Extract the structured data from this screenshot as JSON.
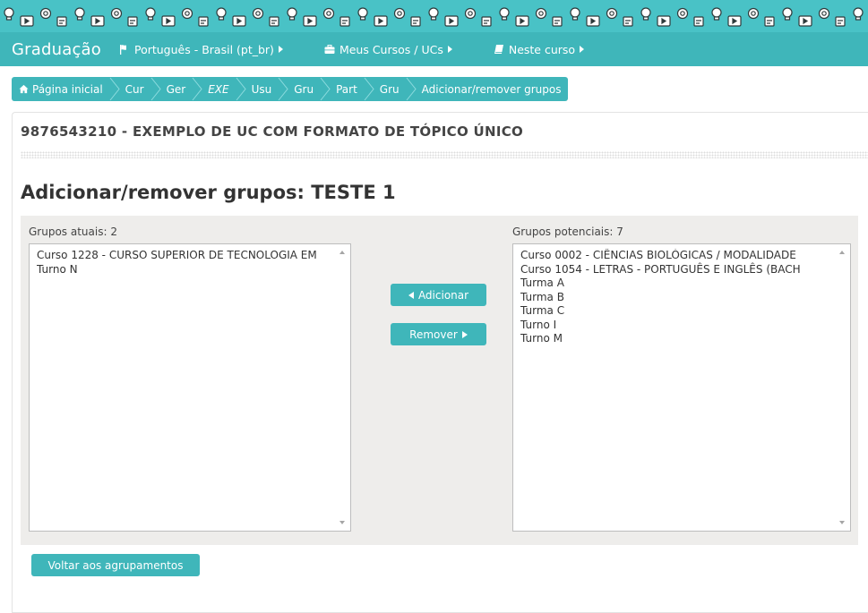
{
  "theme": {
    "primary": "#3fb6ba",
    "banner": "#49c2c6",
    "panel": "#eeedeb"
  },
  "navbar": {
    "brand": "Graduação",
    "items": [
      {
        "icon": "flag-icon",
        "label": "Português - Brasil (pt_br)"
      },
      {
        "icon": "briefcase-icon",
        "label": "Meus Cursos / UCs"
      },
      {
        "icon": "book-icon",
        "label": "Neste curso"
      }
    ]
  },
  "breadcrumb": {
    "items": [
      "Página inicial",
      "Cur",
      "Ger",
      "EXE",
      "Usu",
      "Gru",
      "Part",
      "Gru",
      "Adicionar/remover grupos"
    ]
  },
  "course": {
    "title": "9876543210 - EXEMPLO DE UC COM FORMATO DE TÓPICO ÚNICO"
  },
  "page": {
    "heading": "Adicionar/remover grupos: TESTE 1"
  },
  "current_groups": {
    "label": "Grupos atuais: 2",
    "items": [
      "Curso 1228 - CURSO SUPERIOR DE TECNOLOGIA EM",
      "Turno N"
    ]
  },
  "potential_groups": {
    "label": "Grupos potenciais: 7",
    "items": [
      "Curso 0002 - CIÊNCIAS BIOLÓGICAS / MODALIDADE",
      "Curso 1054 - LETRAS - PORTUGUÊS E INGLÊS (BACH",
      "Turma A",
      "Turma B",
      "Turma C",
      "Turno I",
      "Turno M"
    ]
  },
  "buttons": {
    "add": "Adicionar",
    "remove": "Remover",
    "back": "Voltar aos agrupamentos"
  }
}
